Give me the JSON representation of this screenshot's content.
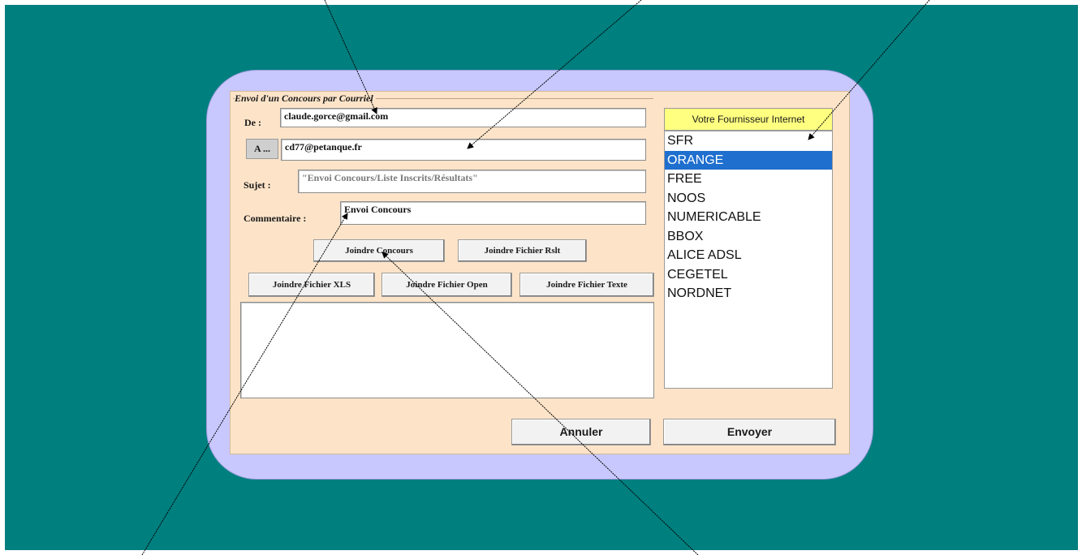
{
  "dialog": {
    "group_title": "Envoi d'un Concours par Courriel",
    "from_label": "De :",
    "from_value": "claude.gorce@gmail.com",
    "to_button": "A ...",
    "to_value": "cd77@petanque.fr",
    "subject_label": "Sujet :",
    "subject_value": "\"Envoi Concours/Liste Inscrits/Résultats\"",
    "comment_label": "Commentaire :",
    "comment_value": "Envoi Concours",
    "buttons": {
      "join_contest": "Joindre Concours",
      "join_rslt": "Joindre Fichier Rslt",
      "join_xls": "Joindre Fichier XLS",
      "join_open": "Joindre Fichier Open",
      "join_text": "Joindre Fichier Texte",
      "cancel": "Annuler",
      "send": "Envoyer"
    }
  },
  "isp": {
    "header": "Votre Fournisseur Internet",
    "items": [
      "SFR",
      "ORANGE",
      "FREE",
      "NOOS",
      "NUMERICABLE",
      "BBOX",
      "ALICE ADSL",
      "CEGETEL",
      "NORDNET"
    ],
    "selected": "ORANGE"
  },
  "colors": {
    "desktop": "#007f7f",
    "frame": "#c8c8ff",
    "panel": "#fde4c9",
    "isp_header": "#ffff80",
    "selection": "#1f6fce"
  }
}
